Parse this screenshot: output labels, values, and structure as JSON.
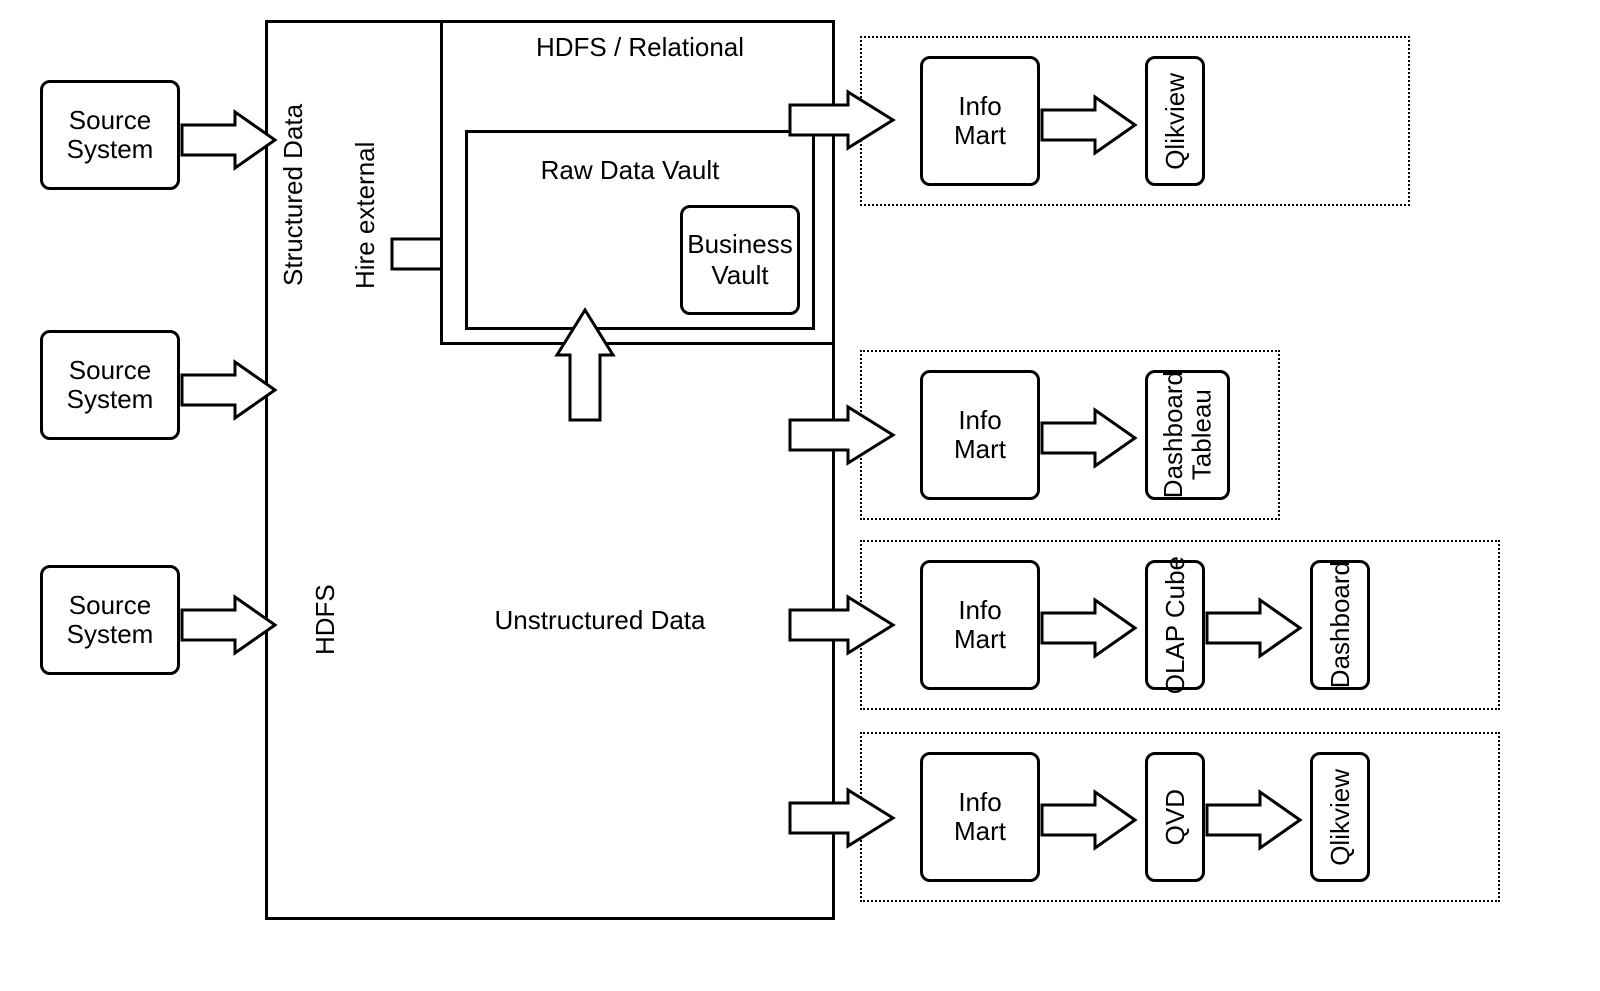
{
  "sources": {
    "s1": "Source\nSystem",
    "s2": "Source\nSystem",
    "s3": "Source\nSystem"
  },
  "staging": {
    "structured_label": "Structured Data",
    "hire_external_label": "Hire external",
    "hdfs_label": "HDFS"
  },
  "vault": {
    "header": "HDFS / Relational",
    "raw_label": "Raw Data Vault",
    "business_label": "Business\nVault"
  },
  "center": {
    "unstructured_label": "Unstructured Data"
  },
  "lane1": {
    "info_mart": "Info\nMart",
    "out": "Qlikview"
  },
  "lane2": {
    "info_mart": "Info\nMart",
    "out": "Dashboard\nTableau"
  },
  "lane3": {
    "info_mart": "Info\nMart",
    "mid": "OLAP Cube",
    "out": "Dashboard"
  },
  "lane4": {
    "info_mart": "Info\nMart",
    "mid": "QVD",
    "out": "Qlikview"
  }
}
